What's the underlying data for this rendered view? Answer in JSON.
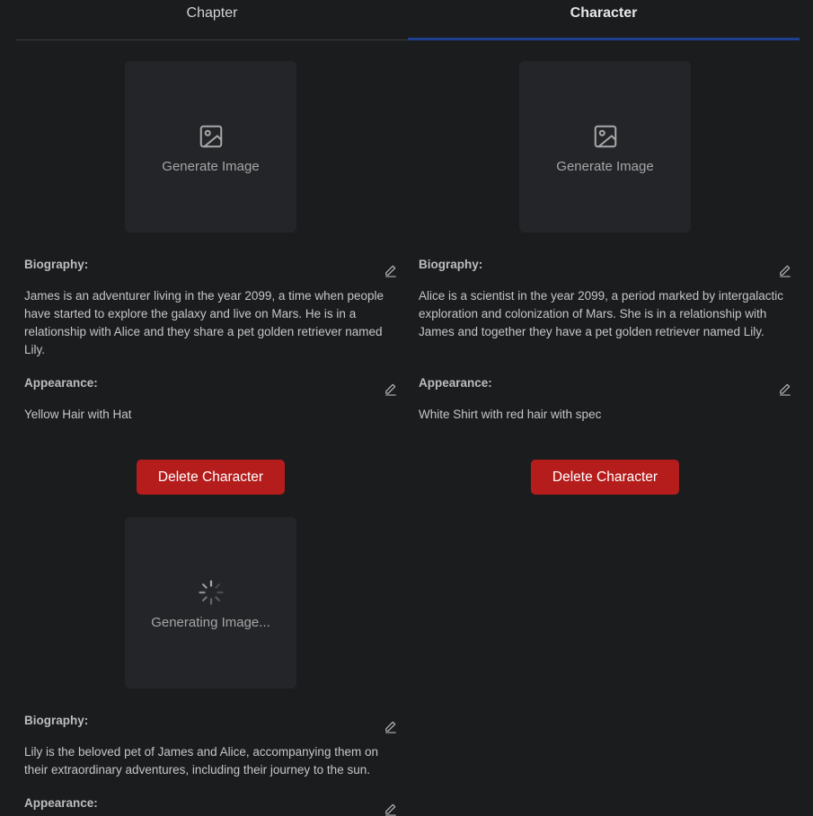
{
  "tabs": [
    {
      "label": "Chapter",
      "active": false
    },
    {
      "label": "Character",
      "active": true
    }
  ],
  "characters": [
    {
      "image_label": "Generate Image",
      "biography_label": "Biography:",
      "biography": "James is an adventurer living in the year 2099, a time when people have started to explore the galaxy and live on Mars. He is in a relationship with Alice and they share a pet golden retriever named Lily.",
      "appearance_label": "Appearance:",
      "appearance": "Yellow Hair with Hat",
      "delete_label": "Delete Character"
    },
    {
      "image_label": "Generate Image",
      "biography_label": "Biography:",
      "biography": "Alice is a scientist in the year 2099, a period marked by intergalactic exploration and colonization of Mars. She is in a relationship with James and together they have a pet golden retriever named Lily.",
      "appearance_label": "Appearance:",
      "appearance": "White Shirt with red hair with spec",
      "delete_label": "Delete Character"
    },
    {
      "image_label": "Generating Image...",
      "biography_label": "Biography:",
      "biography": "Lily is the beloved pet of James and Alice, accompanying them on their extraordinary adventures, including their journey to the sun.",
      "appearance_label": "Appearance:"
    }
  ],
  "colors": {
    "background": "#1b1c1e",
    "card": "#242528",
    "accent": "#1f3f8f",
    "danger": "#b51d1d"
  }
}
